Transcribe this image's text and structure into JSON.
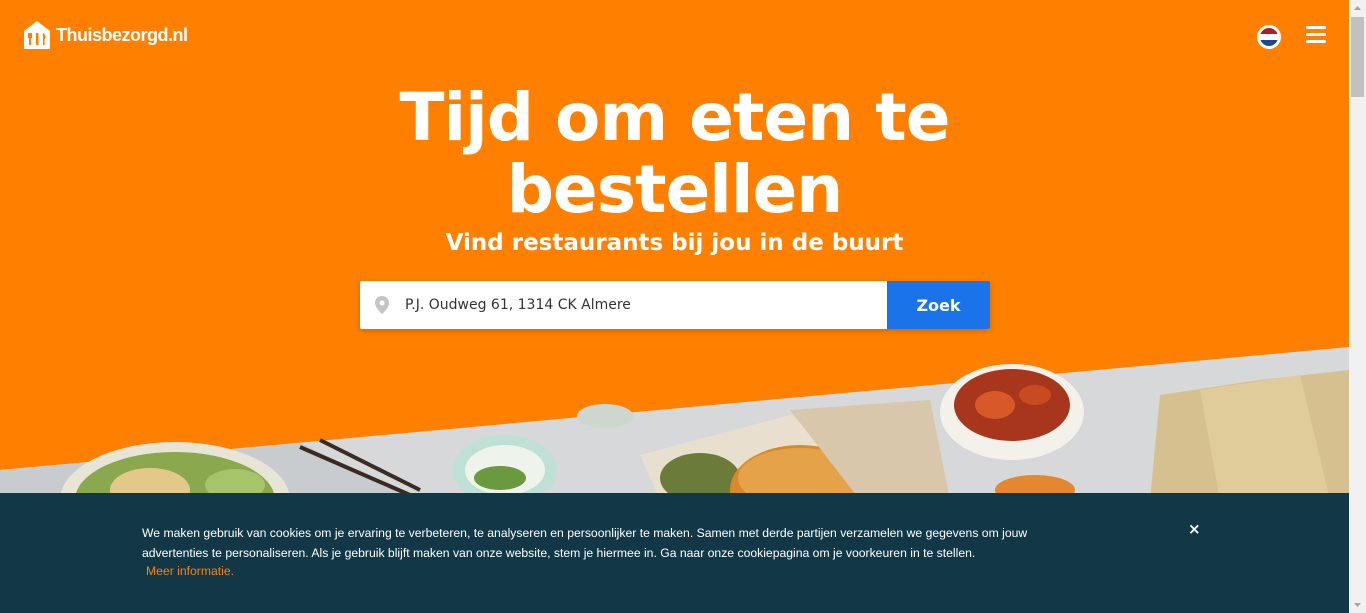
{
  "header": {
    "logo_text": "Thuisbezorgd.nl",
    "logo_icon": "house-cutlery-icon",
    "language_icon": "dutch-flag-icon",
    "menu_icon": "hamburger-menu-icon"
  },
  "hero": {
    "title_line1": "Tijd om eten te",
    "title_line2": "bestellen",
    "subtitle": "Vind restaurants bij jou in de buurt"
  },
  "search": {
    "value": "P.J. Oudweg 61, 1314 CK Almere",
    "pin_icon": "location-pin-icon",
    "button_label": "Zoek"
  },
  "cookie_banner": {
    "text": "We maken gebruik van cookies om je ervaring te verbeteren, te analyseren en persoonlijker te maken. Samen met derde partijen verzamelen we gegevens om jouw advertenties te personaliseren. Als je gebruik blijft maken van onze website, stem je hiermee in. Ga naar onze cookiepagina om je voorkeuren in te stellen.",
    "link_label": "Meer informatie.",
    "close_label": "×"
  },
  "colors": {
    "brand_orange": "#ff8000",
    "search_button": "#1a73e8",
    "cookie_background": "#123848",
    "link": "#ff8000"
  }
}
